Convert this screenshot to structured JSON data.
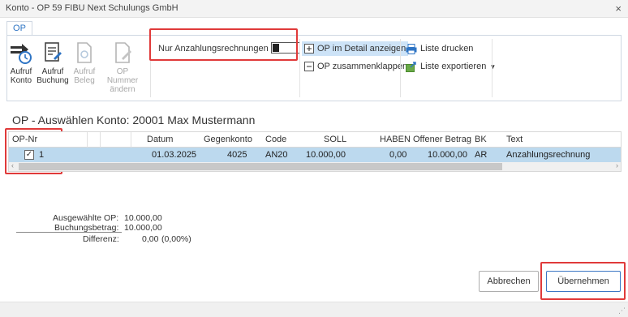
{
  "window": {
    "title": "Konto - OP 59 FIBU Next Schulungs GmbH",
    "close_glyph": "×"
  },
  "ribbon": {
    "tab_label": "OP",
    "buttons": [
      {
        "label_line1": "Aufruf",
        "label_line2": "Konto",
        "icon": "account-call-icon",
        "enabled": true
      },
      {
        "label_line1": "Aufruf",
        "label_line2": "Buchung",
        "icon": "booking-call-icon",
        "enabled": true
      },
      {
        "label_line1": "Aufruf",
        "label_line2": "Beleg",
        "icon": "document-call-icon",
        "enabled": false
      },
      {
        "label_line1": "OP Nummer",
        "label_line2": "ändern",
        "icon": "edit-number-icon",
        "enabled": false
      }
    ],
    "toggle_label": "Nur Anzahlungsrechnungen",
    "detail_label": "OP im Detail anzeigen",
    "collapse_label": "OP zusammenklappen",
    "print_label": "Liste drucken",
    "export_label": "Liste exportieren"
  },
  "panel": {
    "title": "OP - Auswählen  Konto: 20001 Max Mustermann"
  },
  "grid": {
    "columns": [
      "OP-Nr",
      "Datum",
      "Gegenkonto",
      "Code",
      "SOLL",
      "HABEN",
      "Offener Betrag",
      "BK",
      "Text"
    ],
    "rows": [
      {
        "checked": true,
        "op_nr": "1",
        "datum": "01.03.2025",
        "gegenkonto": "4025",
        "code": "AN20",
        "soll": "10.000,00",
        "haben": "0,00",
        "offener_betrag": "10.000,00",
        "bk": "AR",
        "text": "Anzahlungsrechnung"
      }
    ],
    "scroll_left": "‹",
    "scroll_right": "›"
  },
  "summary": {
    "selected_label": "Ausgewählte OP:",
    "selected_value": "10.000,00",
    "booking_label": "Buchungsbetrag:",
    "booking_value": "10.000,00",
    "diff_label": "Differenz:",
    "diff_value": "0,00",
    "diff_percent": "(0,00%)"
  },
  "actions": {
    "cancel_label": "Abbrechen",
    "accept_label": "Übernehmen"
  },
  "colors": {
    "highlight": "#e03a3a",
    "selected_row": "#bcd9ee",
    "accent": "#2e74c4"
  }
}
